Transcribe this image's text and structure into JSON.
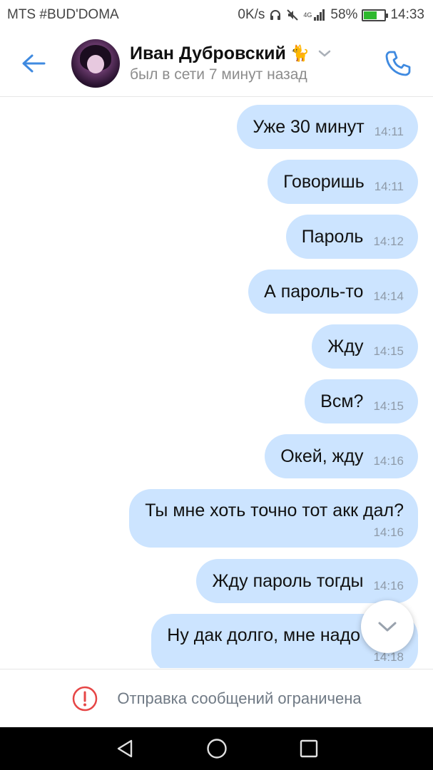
{
  "status_bar": {
    "carrier": "MTS #BUD'DOMA",
    "speed": "0K/s",
    "network": "4G",
    "battery": "58%",
    "battery_level": 0.58,
    "time": "14:33"
  },
  "header": {
    "name": "Иван Дубровский",
    "emoji": "🐈",
    "status": "был в сети 7 минут назад"
  },
  "messages": [
    {
      "text": "Уже 30 минут",
      "time": "14:11"
    },
    {
      "text": "Говоришь",
      "time": "14:11"
    },
    {
      "text": "Пароль",
      "time": "14:12"
    },
    {
      "text": "А пароль-то",
      "time": "14:14"
    },
    {
      "text": "Жду",
      "time": "14:15"
    },
    {
      "text": "Всм?",
      "time": "14:15"
    },
    {
      "text": "Окей, жду",
      "time": "14:16"
    },
    {
      "text": "Ты мне хоть точно тот акк дал?",
      "time": "14:16"
    },
    {
      "text": "Жду пароль тогды",
      "time": "14:16"
    },
    {
      "text": "Ну дак долго, мне надо идти",
      "time": "14:18"
    }
  ],
  "footer": {
    "restricted_text": "Отправка сообщений ограничена"
  },
  "colors": {
    "accent": "#3f8ae0",
    "bubble": "#cce4ff",
    "warning": "#e64646",
    "battery_fill": "#2eb82e"
  },
  "icons": {
    "back": "arrow-left-icon",
    "call": "phone-icon",
    "chevron": "chevron-down-icon",
    "scroll": "chevron-down-icon",
    "warning": "exclamation-circle-icon",
    "nav_back": "triangle-back-icon",
    "nav_home": "circle-home-icon",
    "nav_recent": "square-recent-icon"
  }
}
